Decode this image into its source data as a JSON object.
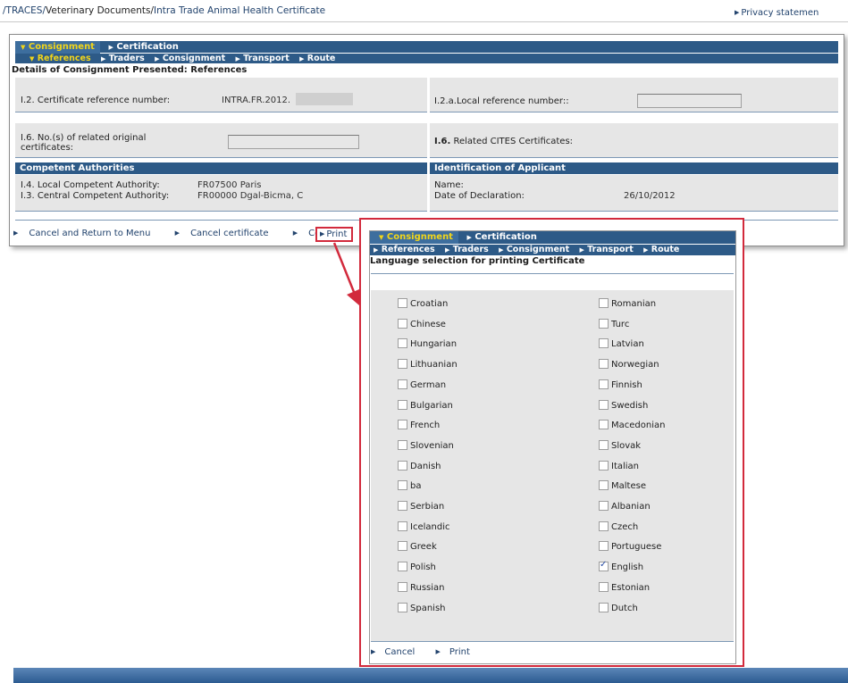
{
  "breadcrumb": {
    "item1": "/TRACES/",
    "item2": "Veterinary Documents",
    "sep": "/",
    "item3": "Intra Trade Animal Health Certificate"
  },
  "privacy": "Privacy statemen",
  "nav": {
    "tabs": [
      "Consignment",
      "Certification"
    ],
    "subtabs": [
      "References",
      "Traders",
      "Consignment",
      "Transport",
      "Route"
    ]
  },
  "main": {
    "section_title": "Details of Consignment Presented: References",
    "cert_ref_label": "I.2. Certificate reference number:",
    "cert_ref_value": "INTRA.FR.2012.",
    "local_ref_label": "I.2.a.Local reference number::",
    "related_orig_label_1": "I.6. No.(s) of related original",
    "related_orig_label_2": "certificates:",
    "cites_prefix": "I.6.",
    "cites_label": " Related CITES Certificates:",
    "competent_header": "Competent Authorities",
    "applicant_header": "Identification of Applicant",
    "local_auth_label": "I.4. Local Competent Authority:",
    "local_auth_value": "FR07500 Paris",
    "central_auth_label": "I.3. Central Competent Authority:",
    "central_auth_value": "FR00000 Dgal-Bicma, C",
    "name_label": "Name:",
    "decl_label": "Date of Declaration:",
    "decl_value": "26/10/2012"
  },
  "actions": {
    "cancel_return": "Cancel and Return to Menu",
    "cancel_cert": "Cancel certificate",
    "control": "Control",
    "print": "Print"
  },
  "popup": {
    "title": "Language selection for printing Certificate",
    "left_langs": [
      {
        "label": "Croatian",
        "checked": false
      },
      {
        "label": "Chinese",
        "checked": false
      },
      {
        "label": "Hungarian",
        "checked": false
      },
      {
        "label": "Lithuanian",
        "checked": false
      },
      {
        "label": "German",
        "checked": false
      },
      {
        "label": "Bulgarian",
        "checked": false
      },
      {
        "label": "French",
        "checked": false
      },
      {
        "label": "Slovenian",
        "checked": false
      },
      {
        "label": "Danish",
        "checked": false
      },
      {
        "label": "ba",
        "checked": false
      },
      {
        "label": "Serbian",
        "checked": false
      },
      {
        "label": "Icelandic",
        "checked": false
      },
      {
        "label": "Greek",
        "checked": false
      },
      {
        "label": "Polish",
        "checked": false
      },
      {
        "label": "Russian",
        "checked": false
      },
      {
        "label": "Spanish",
        "checked": false
      }
    ],
    "right_langs": [
      {
        "label": "Romanian",
        "checked": false
      },
      {
        "label": "Turc",
        "checked": false
      },
      {
        "label": "Latvian",
        "checked": false
      },
      {
        "label": "Norwegian",
        "checked": false
      },
      {
        "label": "Finnish",
        "checked": false
      },
      {
        "label": "Swedish",
        "checked": false
      },
      {
        "label": "Macedonian",
        "checked": false
      },
      {
        "label": "Slovak",
        "checked": false
      },
      {
        "label": "Italian",
        "checked": false
      },
      {
        "label": "Maltese",
        "checked": false
      },
      {
        "label": "Albanian",
        "checked": false
      },
      {
        "label": "Czech",
        "checked": false
      },
      {
        "label": "Portuguese",
        "checked": false
      },
      {
        "label": "English",
        "checked": true
      },
      {
        "label": "Estonian",
        "checked": false
      },
      {
        "label": "Dutch",
        "checked": false
      }
    ],
    "cancel": "Cancel",
    "print": "Print"
  },
  "colors": {
    "nav_blue": "#2d5a87",
    "active_tab_yellow": "#f1d51a",
    "highlight_red": "#d22a3c",
    "panel_grey": "#e6e6e6"
  }
}
